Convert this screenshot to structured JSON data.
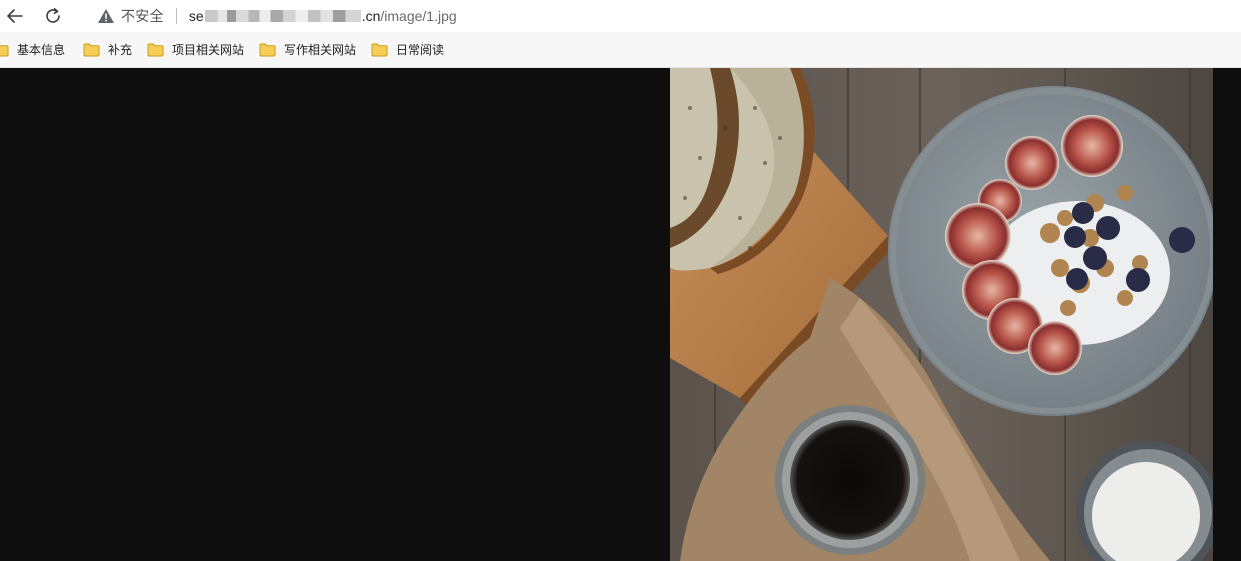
{
  "toolbar": {
    "back_icon": "arrow-left-icon",
    "reload_icon": "reload-icon",
    "security_icon": "warning-triangle-icon",
    "security_label": "不安全",
    "url_start": "se",
    "url_tail": ".cn",
    "url_path": "/image/1.jpg"
  },
  "bookmarks": [
    {
      "label": "基本信息",
      "icon": "folder-icon"
    },
    {
      "label": "补充",
      "icon": "folder-icon"
    },
    {
      "label": "项目相关网站",
      "icon": "folder-icon"
    },
    {
      "label": "写作相关网站",
      "icon": "folder-icon"
    },
    {
      "label": "日常阅读",
      "icon": "folder-icon"
    }
  ],
  "colors": {
    "page_background": "#0e0e0e",
    "folder": "#f5c748"
  }
}
